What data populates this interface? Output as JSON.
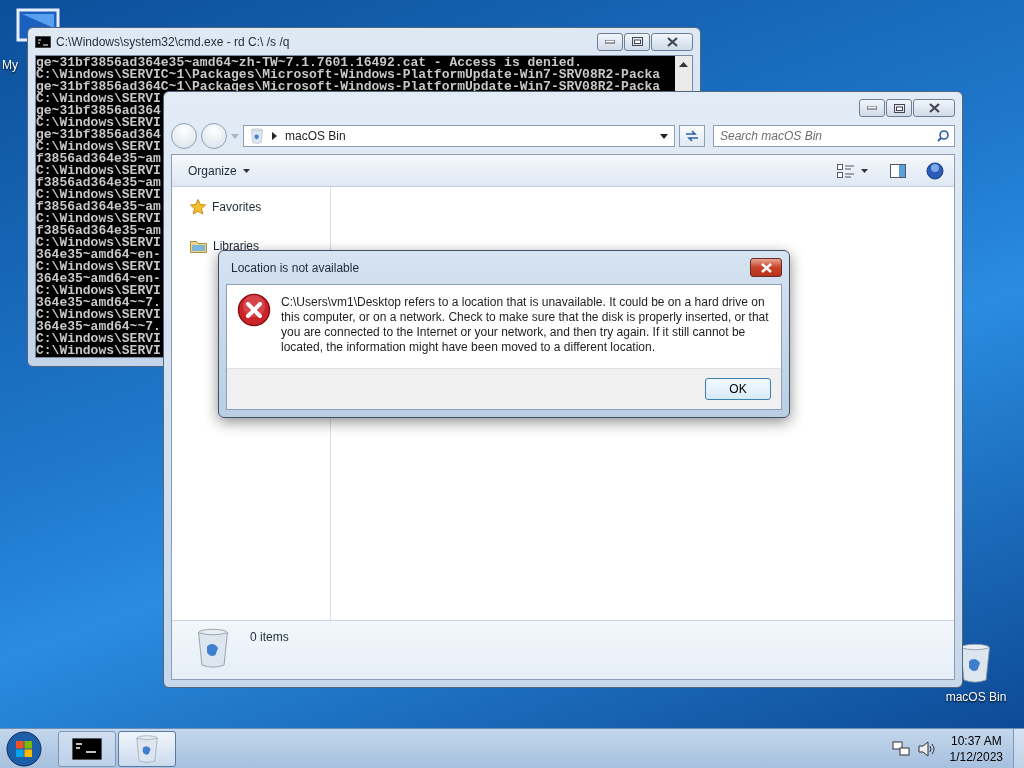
{
  "desktop_icons": [
    {
      "kind": "computer",
      "label": "My"
    },
    {
      "kind": "recycle_bin",
      "label": "macOS Bin"
    }
  ],
  "console_window": {
    "title": "C:\\Windows\\system32\\cmd.exe - rd C:\\ /s /q",
    "lines": [
      "ge~31bf3856ad364e35~amd64~zh-TW~7.1.7601.16492.cat - Access is denied.",
      "C:\\Windows\\SERVIC~1\\Packages\\Microsoft-Windows-PlatformUpdate-Win7-SRV08R2-Packa",
      "ge~31bf3856ad364C~1\\Packages\\Microsoft-Windows-PlatformUpdate-Win7-SRV08R2-Packa",
      "C:\\Windows\\SERVI",
      "ge~31bf3856ad364",
      "C:\\Windows\\SERVI",
      "ge~31bf3856ad364",
      "C:\\Windows\\SERVI",
      "f3856ad364e35~am",
      "C:\\Windows\\SERVI",
      "f3856ad364e35~am",
      "C:\\Windows\\SERVI",
      "f3856ad364e35~am",
      "C:\\Windows\\SERVI",
      "f3856ad364e35~am",
      "C:\\Windows\\SERVI",
      "364e35~amd64~en-",
      "C:\\Windows\\SERVI",
      "364e35~amd64~en-",
      "C:\\Windows\\SERVI",
      "364e35~amd64~~7.",
      "C:\\Windows\\SERVI",
      "364e35~amd64~~7.",
      "C:\\Windows\\SERVI",
      "C:\\Windows\\SERVI"
    ]
  },
  "explorer_window": {
    "address": "macOS Bin",
    "search": {
      "placeholder": "Search macOS Bin"
    },
    "toolbar": {
      "organize": "Organize"
    },
    "nav_pane": [
      {
        "kind": "favorites",
        "label": "Favorites"
      },
      {
        "kind": "libraries",
        "label": "Libraries"
      }
    ],
    "details": {
      "item_count": "0 items"
    }
  },
  "dialog": {
    "title": "Location is not available",
    "message": "C:\\Users\\vm1\\Desktop refers to a location that is unavailable. It could be on a hard drive on this computer, or on a network. Check to make sure that the disk is properly inserted, or that you are connected to the Internet or your network, and then try again. If it still cannot be located, the information might have been moved to a different location.",
    "buttons": [
      "OK"
    ]
  },
  "taskbar": {
    "buttons": [
      {
        "kind": "console",
        "selected": false
      },
      {
        "kind": "recycle_bin",
        "selected": true
      }
    ],
    "clock": {
      "time": "10:37 AM",
      "date": "1/12/2023"
    }
  }
}
